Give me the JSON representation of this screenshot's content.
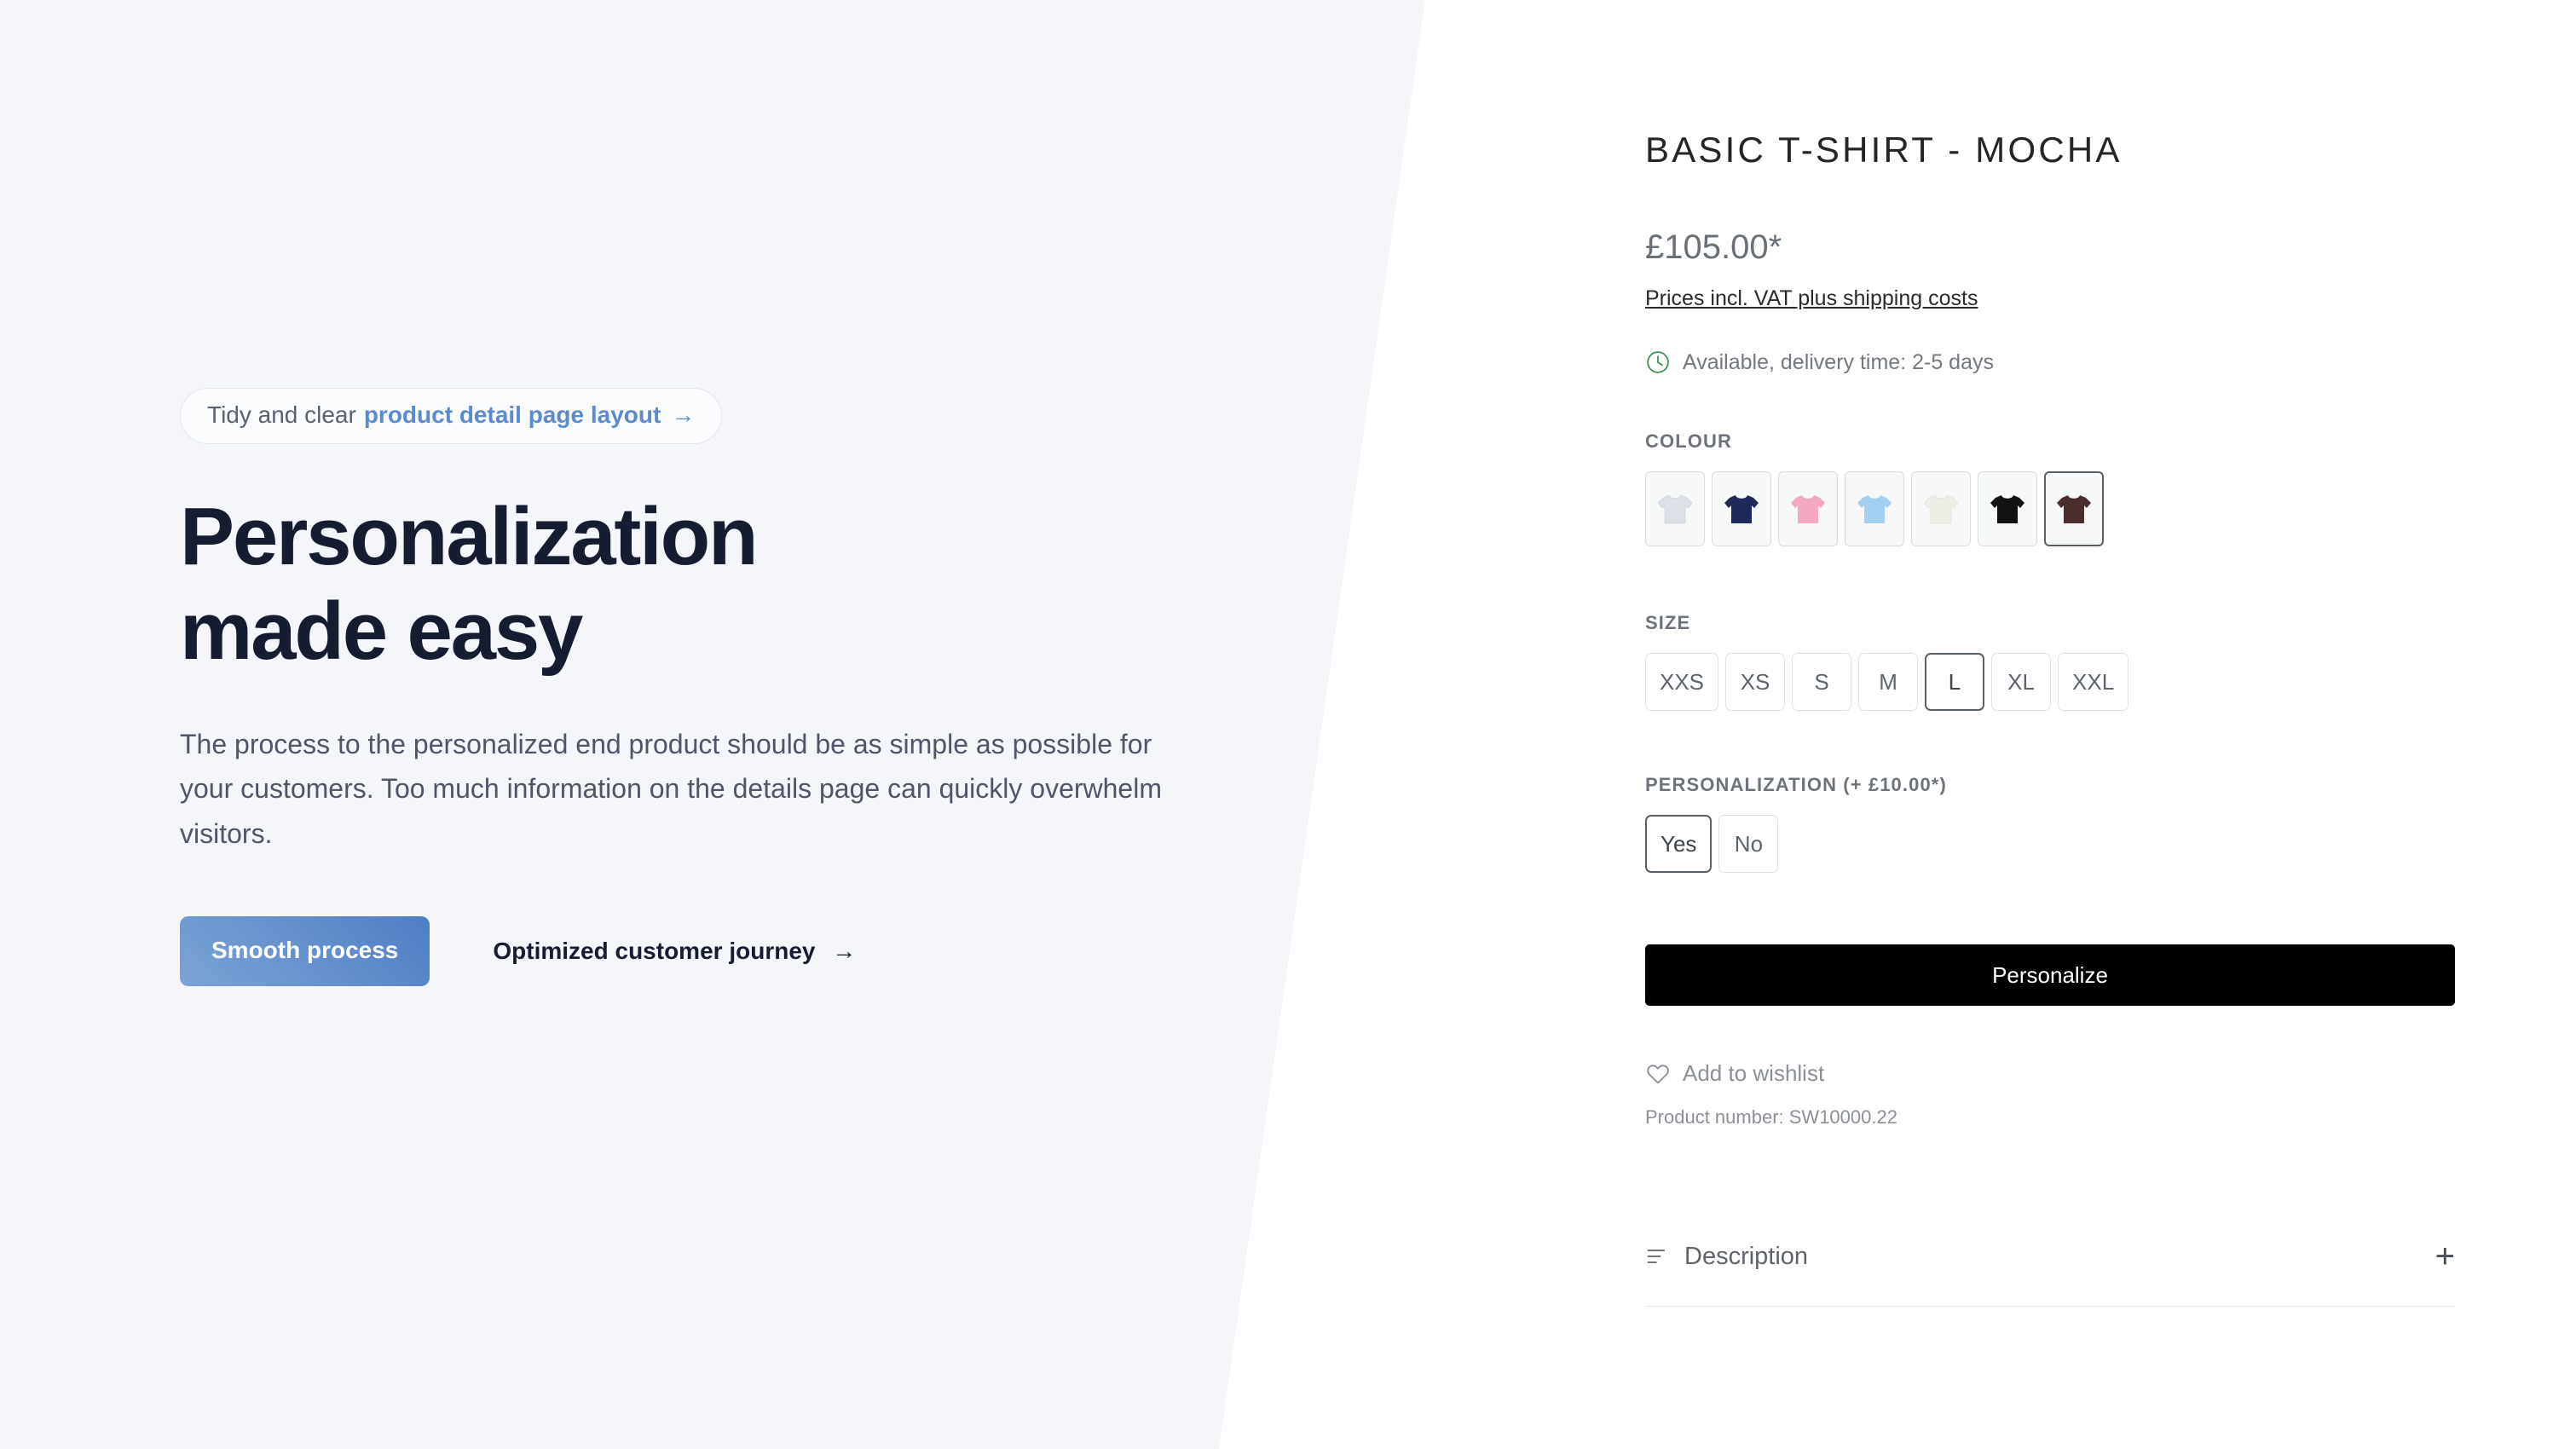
{
  "left": {
    "badge": {
      "prefix": "Tidy and clear",
      "accent": "product detail page layout",
      "arrow": "→"
    },
    "title_line1": "Personalization",
    "title_line2": "made easy",
    "body": "The process to the personalized end product should be as simple as possible for your customers. Too much information on the details page can quickly overwhelm visitors.",
    "primary_button": "Smooth process",
    "secondary_link": "Optimized customer journey",
    "secondary_arrow": "→",
    "accent_color": "#5b8ace",
    "background_color": "#f4f6fa"
  },
  "product": {
    "title": "BASIC T-SHIRT - MOCHA",
    "price": "£105.00*",
    "tax_note": "Prices incl. VAT plus shipping costs",
    "availability": "Available, delivery time: 2-5 days",
    "availability_icon": "clock-icon",
    "availability_icon_color": "#3a9152",
    "colour": {
      "label": "COLOUR",
      "swatches": [
        {
          "name": "Light Grey",
          "hex": "#dde0e6",
          "selected": false
        },
        {
          "name": "Navy",
          "hex": "#1e2a5a",
          "selected": false
        },
        {
          "name": "Pink",
          "hex": "#f5a8c4",
          "selected": false
        },
        {
          "name": "Light Blue",
          "hex": "#a3d0f0",
          "selected": false
        },
        {
          "name": "Cream",
          "hex": "#efeee6",
          "selected": false
        },
        {
          "name": "Black",
          "hex": "#121212",
          "selected": false
        },
        {
          "name": "Mocha",
          "hex": "#4a2e2e",
          "selected": true
        }
      ]
    },
    "size": {
      "label": "SIZE",
      "options": [
        {
          "label": "XXS",
          "selected": false
        },
        {
          "label": "XS",
          "selected": false
        },
        {
          "label": "S",
          "selected": false
        },
        {
          "label": "M",
          "selected": false
        },
        {
          "label": "L",
          "selected": true
        },
        {
          "label": "XL",
          "selected": false
        },
        {
          "label": "XXL",
          "selected": false
        }
      ]
    },
    "personalization": {
      "label": "PERSONALIZATION (+ £10.00*)",
      "options": [
        {
          "label": "Yes",
          "selected": true
        },
        {
          "label": "No",
          "selected": false
        }
      ]
    },
    "cta_button": "Personalize",
    "wishlist": "Add to wishlist",
    "wishlist_icon": "heart-icon",
    "product_number": "Product number: SW10000.22",
    "accordion": {
      "label": "Description",
      "icon": "description-lines-icon",
      "toggle": "+"
    }
  }
}
